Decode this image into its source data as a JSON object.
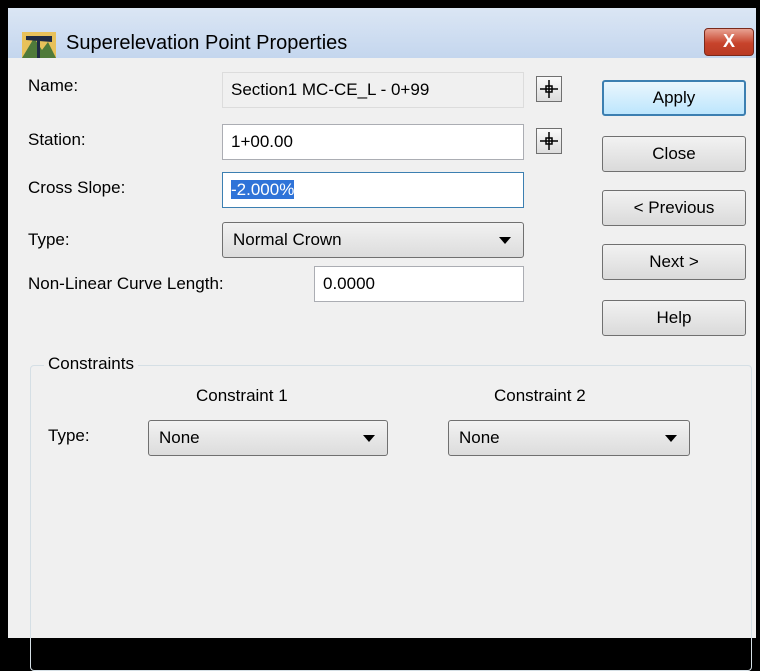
{
  "window": {
    "title": "Superelevation Point Properties",
    "close_glyph": "X"
  },
  "fields": {
    "name_label": "Name:",
    "name_value": "Section1  MC-CE_L - 0+99",
    "station_label": "Station:",
    "station_value": "1+00.00",
    "cross_slope_label": "Cross Slope:",
    "cross_slope_value": "-2.000%",
    "type_label": "Type:",
    "type_value": "Normal Crown",
    "nonlinear_label": "Non-Linear Curve Length:",
    "nonlinear_value": "0.0000"
  },
  "buttons": {
    "apply": "Apply",
    "close": "Close",
    "previous": "< Previous",
    "next": "Next >",
    "help": "Help"
  },
  "constraints": {
    "legend": "Constraints",
    "col1_header": "Constraint 1",
    "col2_header": "Constraint 2",
    "type_label": "Type:",
    "constraint1_value": "None",
    "constraint2_value": "None"
  },
  "icons": {
    "title": "superelevation-app-icon",
    "pick": "crosshair-pick-icon",
    "dropdown": "chevron-down-icon"
  }
}
